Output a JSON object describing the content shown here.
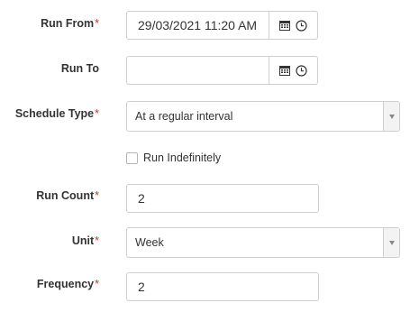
{
  "form": {
    "run_from": {
      "label": "Run From",
      "required": "*",
      "value": "29/03/2021 11:20 AM",
      "icons": [
        "calendar-icon",
        "clock-icon"
      ]
    },
    "run_to": {
      "label": "Run To",
      "value": "",
      "icons": [
        "calendar-icon",
        "clock-icon"
      ]
    },
    "schedule_type": {
      "label": "Schedule Type",
      "required": "*",
      "value": "At a regular interval"
    },
    "run_indefinitely": {
      "label": "Run Indefinitely",
      "checked": false
    },
    "run_count": {
      "label": "Run Count",
      "required": "*",
      "value": "2"
    },
    "unit": {
      "label": "Unit",
      "required": "*",
      "value": "Week"
    },
    "frequency": {
      "label": "Frequency",
      "required": "*",
      "value": "2"
    }
  },
  "colors": {
    "required_marker": "#c0392b",
    "border": "#cfcfcf",
    "text": "#333333"
  }
}
